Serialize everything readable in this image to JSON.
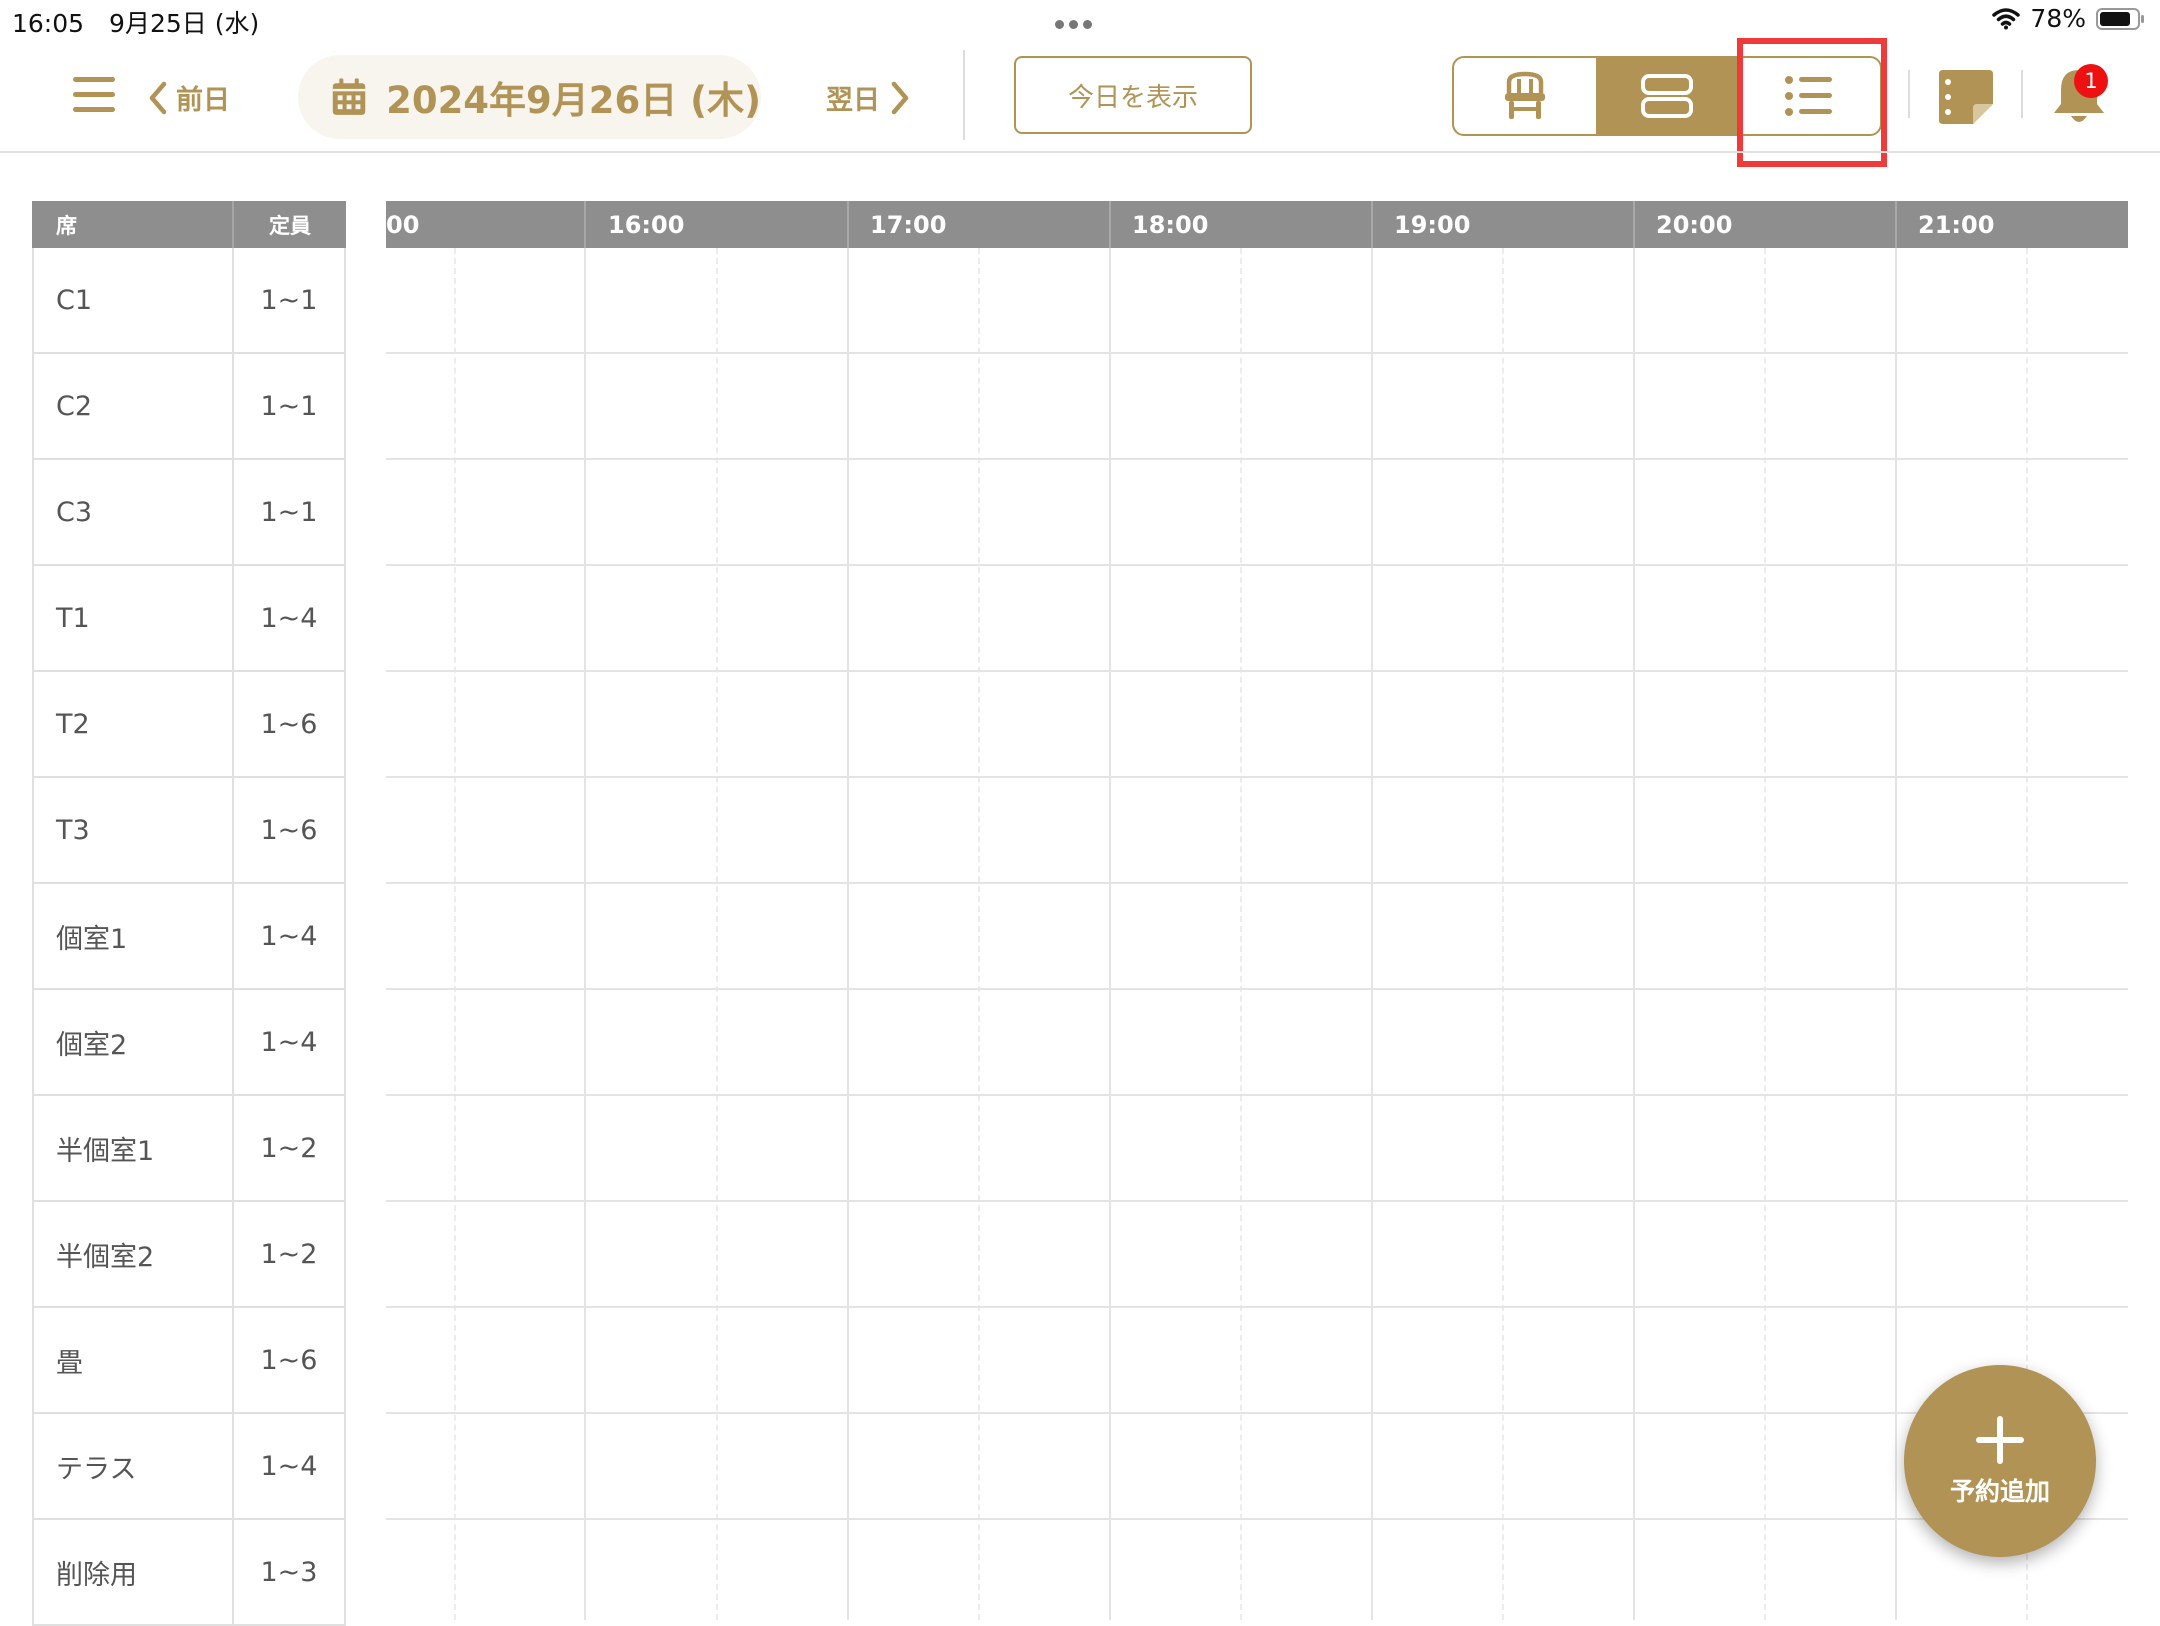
{
  "status_bar": {
    "time_date": "16:05　9月25日 (水)",
    "battery": "78%"
  },
  "toolbar": {
    "prev_label": "前日",
    "date": "2024年9月26日 (木)",
    "next_label": "翌日",
    "today_label": "今日を表示",
    "view_modes": [
      {
        "name": "seat-view",
        "icon": "chair-icon",
        "active": false
      },
      {
        "name": "timeline-view",
        "icon": "rows-icon",
        "active": true
      },
      {
        "name": "list-view",
        "icon": "list-icon",
        "active": false
      }
    ],
    "notification_count": "1"
  },
  "seat_table": {
    "headers": {
      "seat": "席",
      "capacity": "定員"
    },
    "rows": [
      {
        "seat": "C1",
        "capacity": "1~1"
      },
      {
        "seat": "C2",
        "capacity": "1~1"
      },
      {
        "seat": "C3",
        "capacity": "1~1"
      },
      {
        "seat": "T1",
        "capacity": "1~4"
      },
      {
        "seat": "T2",
        "capacity": "1~6"
      },
      {
        "seat": "T3",
        "capacity": "1~6"
      },
      {
        "seat": "個室1",
        "capacity": "1~4"
      },
      {
        "seat": "個室2",
        "capacity": "1~4"
      },
      {
        "seat": "半個室1",
        "capacity": "1~2"
      },
      {
        "seat": "半個室2",
        "capacity": "1~2"
      },
      {
        "seat": "畳",
        "capacity": "1~6"
      },
      {
        "seat": "テラス",
        "capacity": "1~4"
      },
      {
        "seat": "削除用",
        "capacity": "1~3"
      }
    ]
  },
  "timeline": {
    "hours": [
      "00",
      "16:00",
      "17:00",
      "18:00",
      "19:00",
      "20:00",
      "21:00"
    ]
  },
  "fab": {
    "label": "予約追加"
  },
  "colors": {
    "accent": "#b09355",
    "header_gray": "#8e8e8e",
    "highlight": "#f03a3a",
    "badge": "#ee1111"
  }
}
